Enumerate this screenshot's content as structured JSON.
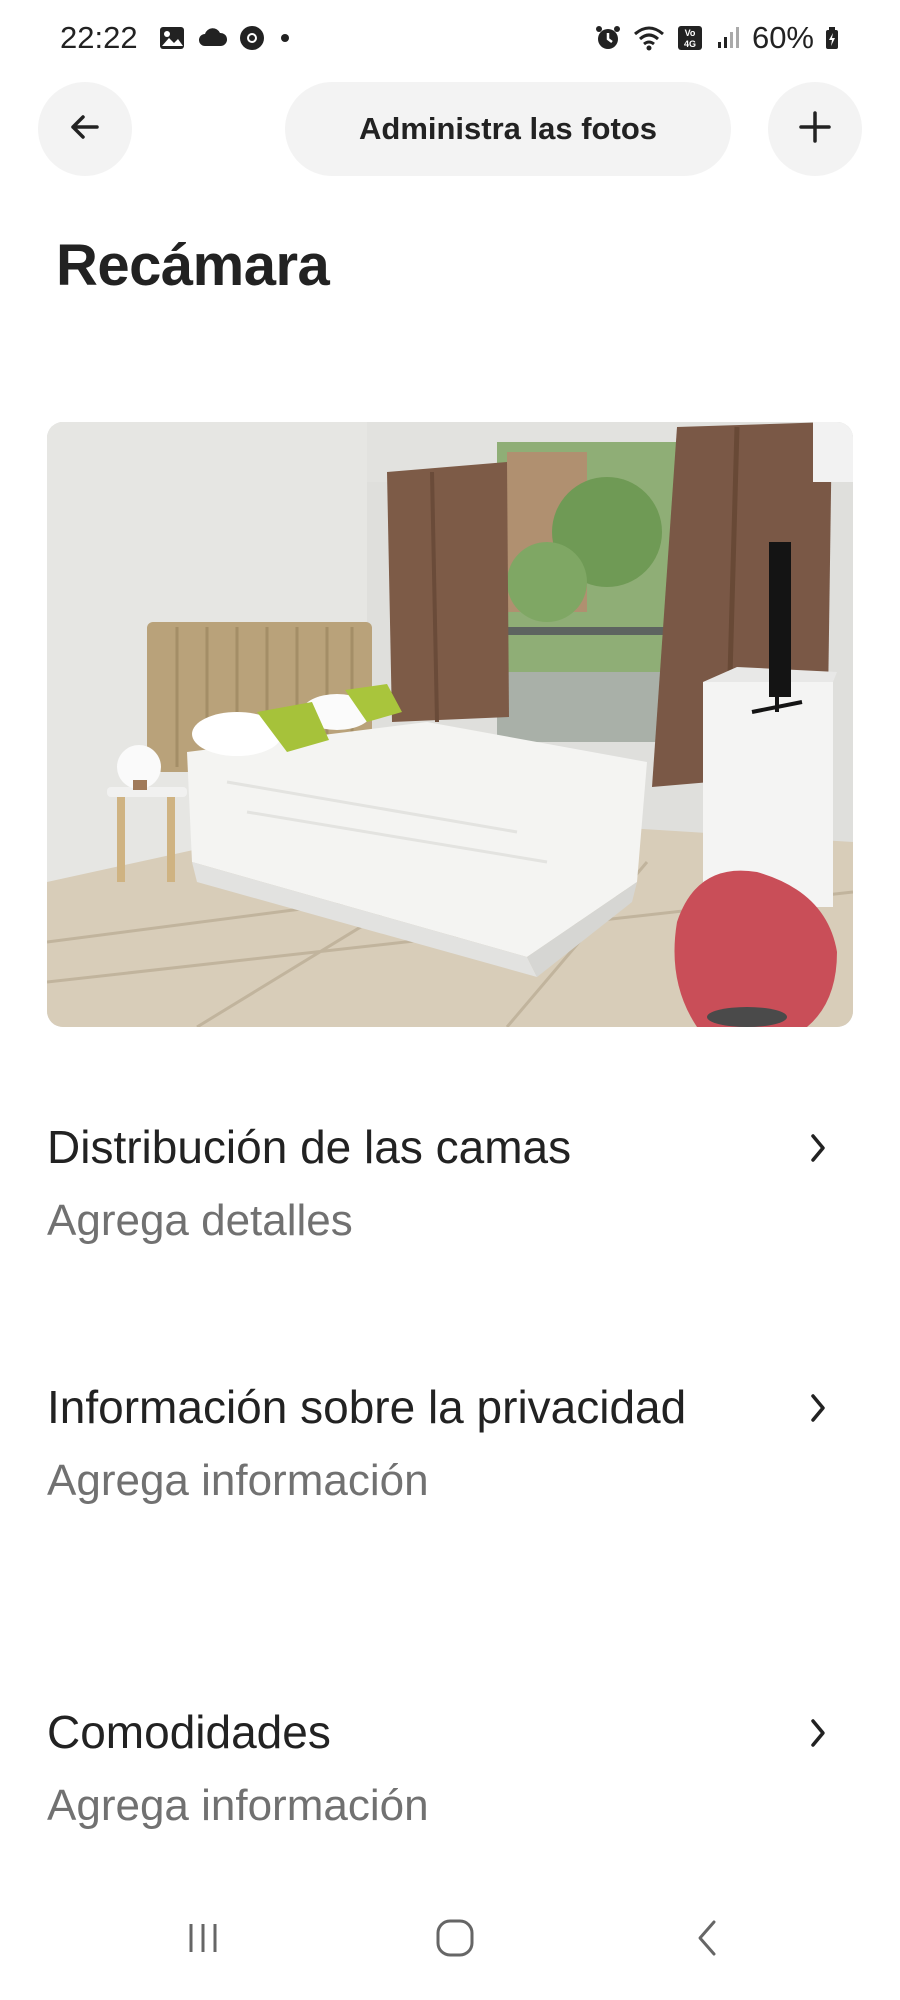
{
  "status_bar": {
    "time": "22:22",
    "battery": "60%",
    "left_icons": [
      "image-icon",
      "cloud-icon",
      "chrome-icon",
      "dot-icon"
    ],
    "right_icons": [
      "alarm-icon",
      "wifi-icon",
      "volte-icon",
      "signal-icon",
      "battery-icon"
    ]
  },
  "header": {
    "title": "Administra las fotos",
    "back_icon": "arrow-left-icon",
    "add_icon": "plus-icon"
  },
  "page": {
    "title": "Recámara"
  },
  "photo": {
    "subject": "bedroom-photo"
  },
  "rows": [
    {
      "title": "Distribución de las camas",
      "subtitle": "Agrega detalles"
    },
    {
      "title": "Información sobre la privacidad",
      "subtitle": "Agrega información"
    },
    {
      "title": "Comodidades",
      "subtitle": "Agrega información"
    }
  ],
  "nav_bar": {
    "icons": [
      "recent-apps-icon",
      "home-icon",
      "back-icon"
    ]
  },
  "colors": {
    "text": "#222222",
    "subtext": "#717171",
    "pill_bg": "#f3f3f3",
    "background": "#ffffff"
  }
}
